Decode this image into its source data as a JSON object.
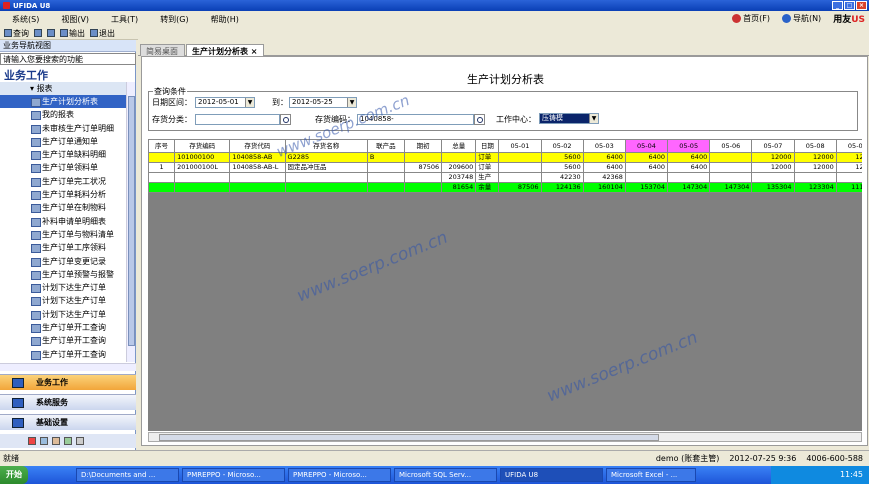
{
  "app": {
    "title": "UFIDA U8"
  },
  "menu": {
    "items": [
      "系统(S)",
      "视图(V)",
      "工具(T)",
      "转到(G)",
      "帮助(H)"
    ],
    "home": "首页(F)",
    "nav": "导航(N)",
    "brand": "用友"
  },
  "toolbar": {
    "query": "查询",
    "output": "输出",
    "exit": "退出"
  },
  "tabs": [
    {
      "label": "简易桌面"
    },
    {
      "label": "生产计划分析表"
    }
  ],
  "sidebar": {
    "header": "业务导航视图",
    "search_placeholder": "请输入您要搜索的功能",
    "title": "业务工作",
    "group": "报表",
    "items": [
      "生产计划分析表",
      "我的报表",
      "未审核生产订单明细",
      "生产订单通知单",
      "生产订单缺料明细",
      "生产订单领料单",
      "生产订单完工状况",
      "生产订单耗料分析",
      "生产订单在制物料",
      "补料申请单明细表",
      "生产订单与物料清单",
      "生产订单工序领料",
      "生产订单变更记录",
      "生产订单预警与报警",
      "计划下达生产订单",
      "计划下达生产订单",
      "计划下达生产订单",
      "生产订单开工查询",
      "生产订单开工查询",
      "生产订单开工查询"
    ],
    "nav_buttons": [
      "业务工作",
      "系统服务",
      "基础设置"
    ]
  },
  "report": {
    "title": "生产计划分析表",
    "query": {
      "legend": "查询条件",
      "date_label": "日期区间：",
      "date_from": "2012-05-01",
      "to_label": "到：",
      "date_to": "2012-05-25",
      "category_label": "存货分类：",
      "category_value": "",
      "code_label": "存货编码：",
      "code_value": "1040858-",
      "center_label": "工作中心：",
      "center_value": "压铸模"
    },
    "columns": [
      "序号",
      "存货编码",
      "存货代码",
      "存货名称",
      "联产品",
      "期初",
      "总量",
      "日期",
      "05-01",
      "05-02",
      "05-03",
      "05-04",
      "05-05",
      "05-06",
      "05-07",
      "05-08",
      "05-09"
    ],
    "rows": [
      {
        "style": "yel",
        "cells": [
          "",
          "101000100",
          "1040858-AB",
          "G2285",
          "B",
          "",
          "",
          "订单",
          "",
          "5600",
          "6400",
          "6400",
          "6400",
          "",
          "12000",
          "12000",
          "12000"
        ]
      },
      {
        "style": "wht",
        "cells": [
          "1",
          "201000100L",
          "1040858-AB-L",
          "固定品冲压品",
          "",
          "87506",
          "209600",
          "订单",
          "",
          "5600",
          "6400",
          "6400",
          "6400",
          "",
          "12000",
          "12000",
          "12000"
        ]
      },
      {
        "style": "wht",
        "cells": [
          "",
          "",
          "",
          "",
          "",
          "",
          "203748",
          "生产",
          "",
          "42230",
          "42368",
          "",
          "",
          "",
          "",
          "",
          ""
        ]
      },
      {
        "style": "grn",
        "cells": [
          "",
          "",
          "",
          "",
          "",
          "",
          "81654",
          "余量",
          "87506",
          "124136",
          "160104",
          "153704",
          "147304",
          "147304",
          "135304",
          "123304",
          "111304"
        ]
      }
    ]
  },
  "status": {
    "left": "就绪",
    "user": "demo (账套主管)",
    "datetime": "2012-07-25  9:36",
    "phone": "4006-600-588"
  },
  "taskbar": {
    "start": "开始",
    "tasks": [
      "D:\\Documents and ...",
      "PMREPPO - Microso...",
      "PMREPPO - Microso...",
      "Microsoft SQL Serv...",
      "UFIDA U8",
      "Microsoft Excel - ..."
    ],
    "clock": "11:45"
  },
  "watermark": "www.soerp.com.cn",
  "colors": {
    "highlight": "#ff66ff",
    "order_row": "#ffff00",
    "balance_row": "#00ff00",
    "selected": "#3163c5"
  }
}
